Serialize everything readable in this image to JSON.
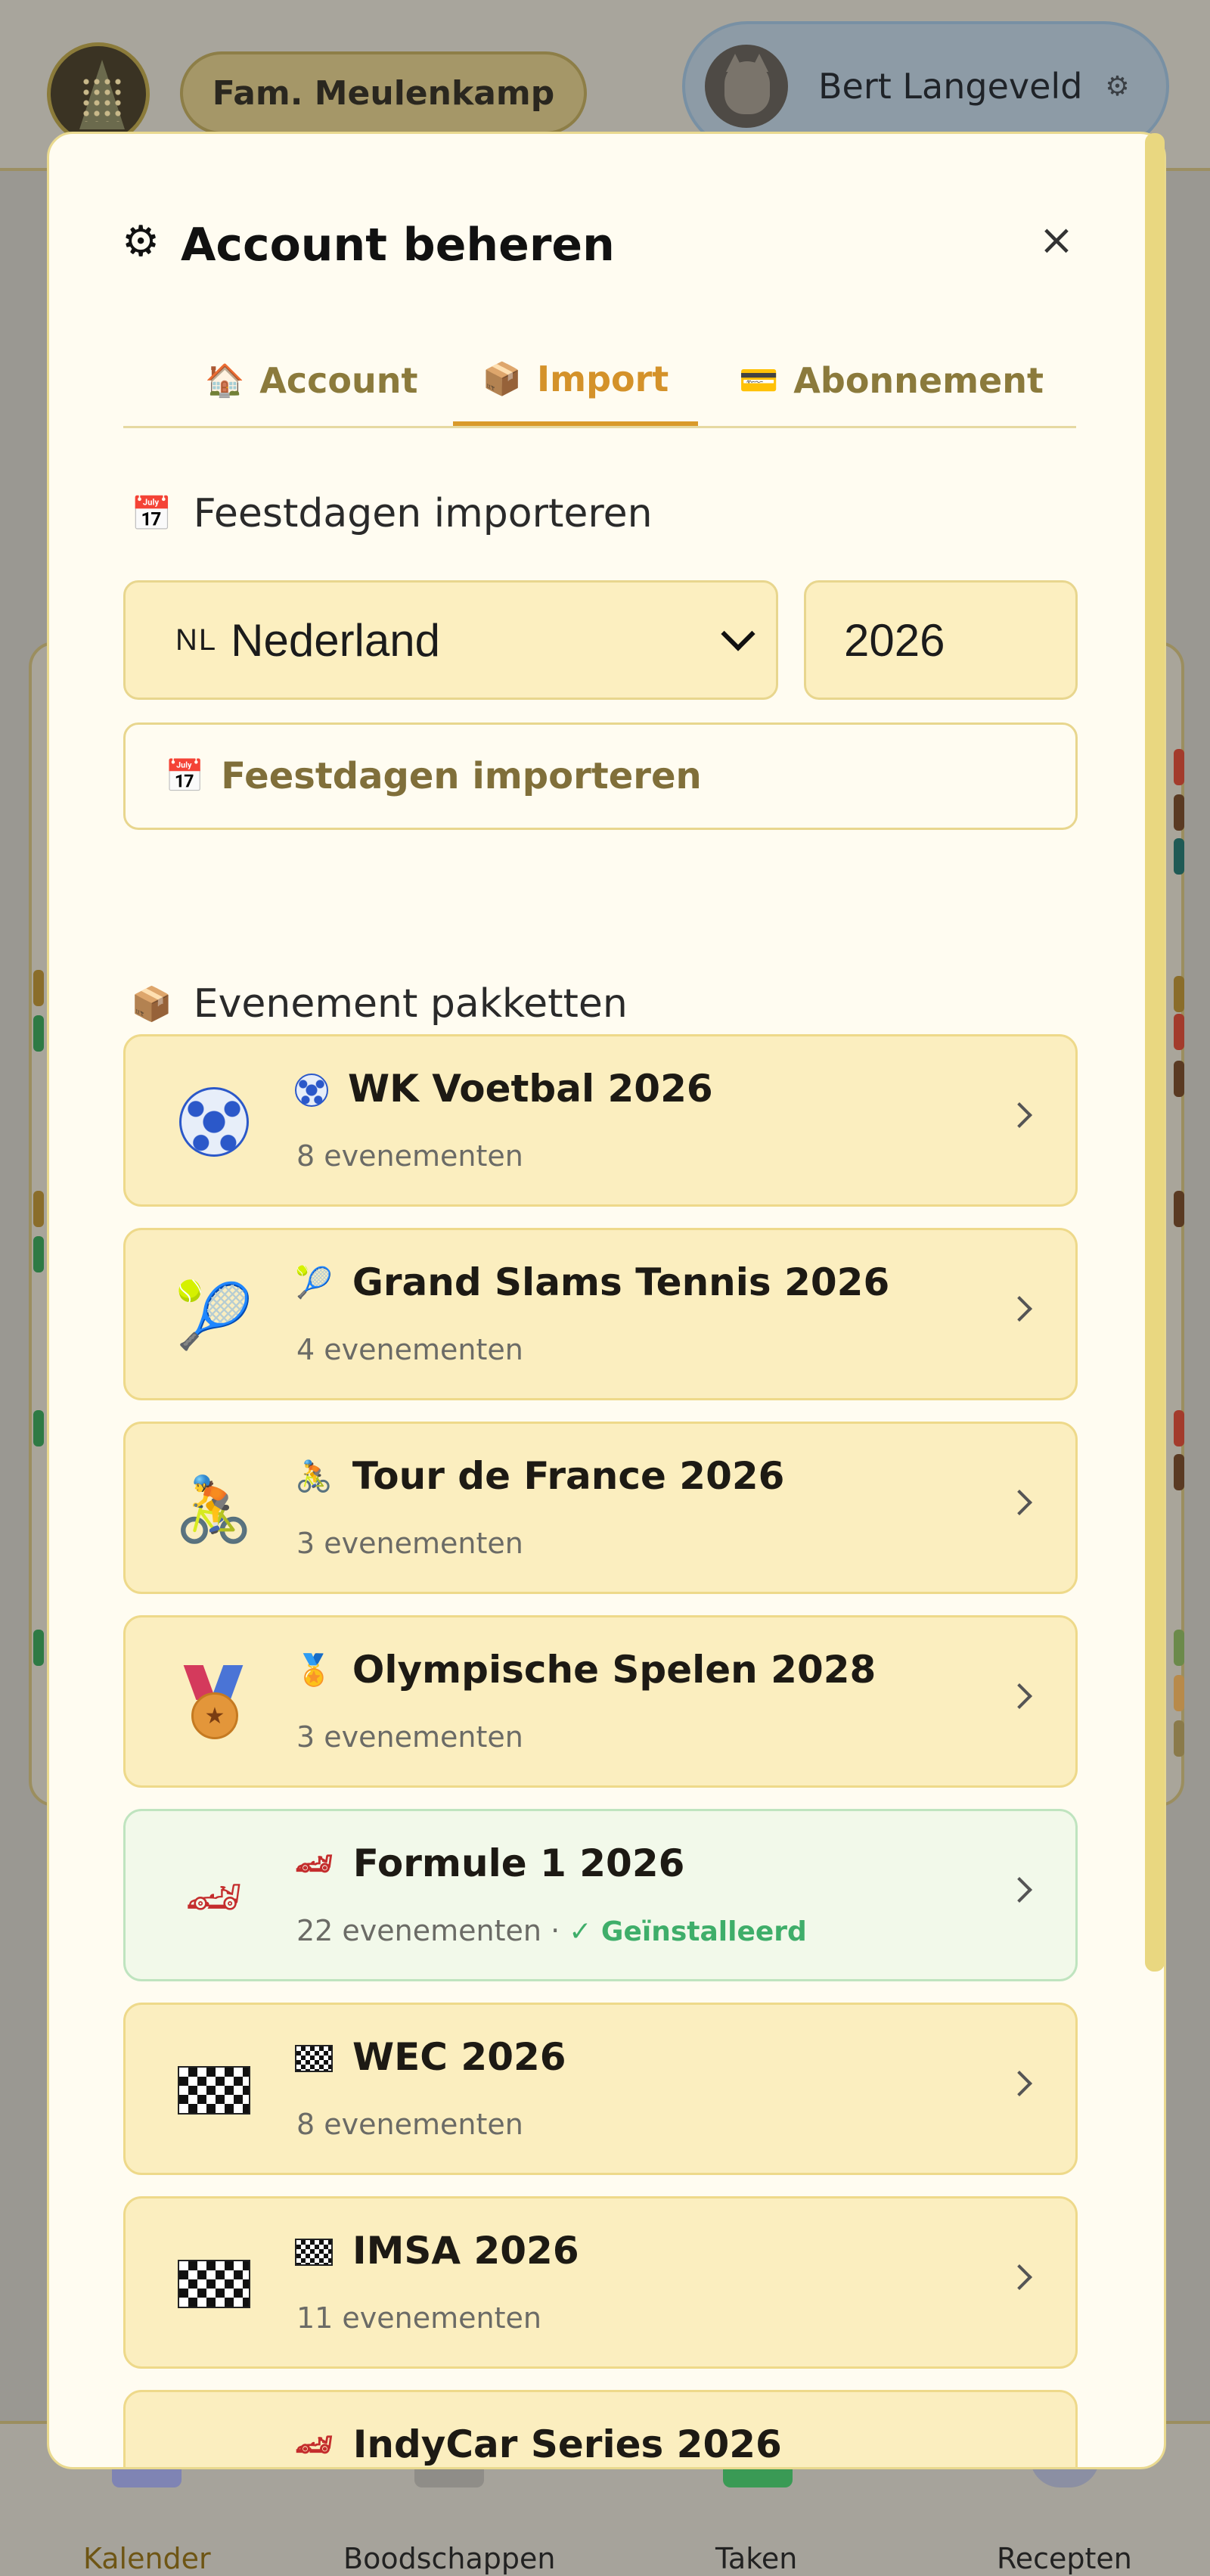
{
  "header": {
    "family_name": "Fam. Meulenkamp",
    "user_name": "Bert Langeveld"
  },
  "bottom_nav": {
    "items": [
      {
        "label": "Kalender"
      },
      {
        "label": "Boodschappen"
      },
      {
        "label": "Taken"
      },
      {
        "label": "Recepten"
      }
    ],
    "active": "Kalender"
  },
  "modal": {
    "title": "Account beheren",
    "title_icon": "gear-icon",
    "close_label": "×",
    "tabs": [
      {
        "label": "Account",
        "icon": "house-icon"
      },
      {
        "label": "Import",
        "icon": "package-icon"
      },
      {
        "label": "Abonnement",
        "icon": "credit-card-icon"
      }
    ],
    "active_tab": "Import",
    "holidays": {
      "heading": "Feestdagen importeren",
      "country_code": "NL",
      "country": "Nederland",
      "year": "2026",
      "button_label": "Feestdagen importeren"
    },
    "packages": {
      "heading": "Evenement pakketten",
      "items": [
        {
          "title": "WK Voetbal 2026",
          "subtitle": "8 evenementen",
          "icon": "soccer-ball-icon"
        },
        {
          "title": "Grand Slams Tennis 2026",
          "subtitle": "4 evenementen",
          "icon": "tennis-racket-icon"
        },
        {
          "title": "Tour de France 2026",
          "subtitle": "3 evenementen",
          "icon": "cyclist-icon"
        },
        {
          "title": "Olympische Spelen 2028",
          "subtitle": "3 evenementen",
          "icon": "medal-icon"
        },
        {
          "title": "Formule 1 2026",
          "subtitle": "22 evenementen · ",
          "status": "✓ Geïnstalleerd",
          "icon": "race-car-icon"
        },
        {
          "title": "WEC 2026",
          "subtitle": "8 evenementen",
          "icon": "checkered-flag-icon"
        },
        {
          "title": "IMSA 2026",
          "subtitle": "11 evenementen",
          "icon": "checkered-flag-icon"
        },
        {
          "title": "IndyCar Series 2026",
          "subtitle": "",
          "icon": "race-car-icon"
        }
      ]
    }
  },
  "colors": {
    "accent": "#d99a2b",
    "card_bg": "#fbeebf",
    "installed_bg": "#f2f9ea",
    "installed_text": "#3fae6a"
  }
}
